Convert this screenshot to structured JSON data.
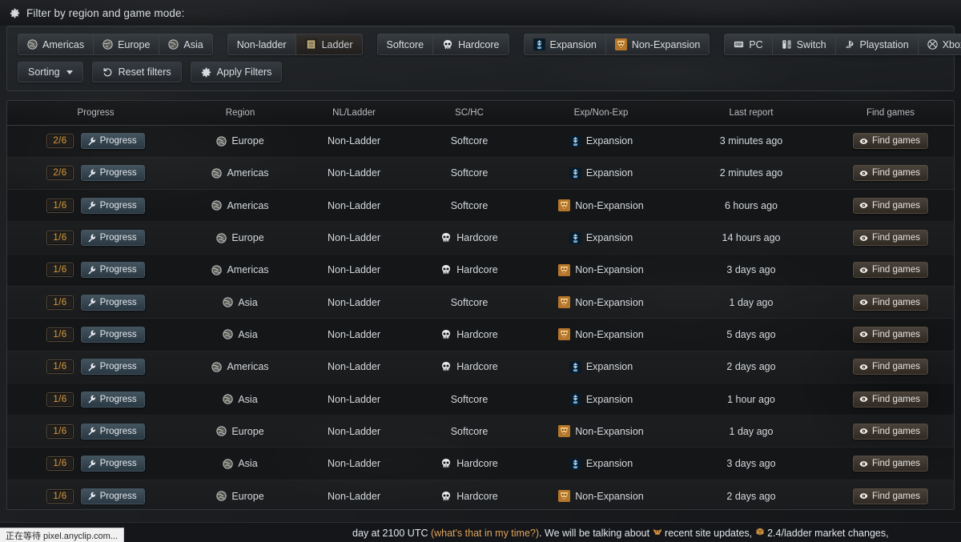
{
  "header": {
    "gear_icon": "gear-icon",
    "title": "Filter by region and game mode:"
  },
  "filters": {
    "groups": [
      {
        "name": "region",
        "buttons": [
          {
            "label": "Americas",
            "icon": "globe-icon",
            "active": true
          },
          {
            "label": "Europe",
            "icon": "globe-icon",
            "active": true
          },
          {
            "label": "Asia",
            "icon": "globe-icon",
            "active": true
          }
        ]
      },
      {
        "name": "ladder",
        "buttons": [
          {
            "label": "Non-ladder",
            "icon": "",
            "active": true
          },
          {
            "label": "Ladder",
            "icon": "ladder-icon",
            "active": false
          }
        ]
      },
      {
        "name": "core",
        "buttons": [
          {
            "label": "Softcore",
            "icon": "",
            "active": true
          },
          {
            "label": "Hardcore",
            "icon": "skull-icon",
            "active": true
          }
        ]
      },
      {
        "name": "expansion",
        "buttons": [
          {
            "label": "Expansion",
            "icon": "expansion-icon",
            "active": true
          },
          {
            "label": "Non-Expansion",
            "icon": "non-expansion-icon",
            "active": true
          }
        ]
      },
      {
        "name": "platform",
        "buttons": [
          {
            "label": "PC",
            "icon": "pc-icon",
            "active": true
          },
          {
            "label": "Switch",
            "icon": "switch-icon",
            "active": true
          },
          {
            "label": "Playstation",
            "icon": "playstation-icon",
            "active": true
          },
          {
            "label": "Xbox",
            "icon": "xbox-icon",
            "active": true
          }
        ]
      }
    ],
    "actions": {
      "sorting_label": "Sorting",
      "reset_label": "Reset filters",
      "reset_icon": "undo-icon",
      "apply_label": "Apply Filters",
      "apply_icon": "gear-icon"
    }
  },
  "table": {
    "columns": [
      "Progress",
      "Region",
      "NL/Ladder",
      "SC/HC",
      "Exp/Non-Exp",
      "Last report",
      "Find games"
    ],
    "progress_button_label": "Progress",
    "progress_button_icon": "wrench-icon",
    "find_button_label": "Find games",
    "find_button_icon": "eye-icon",
    "rows": [
      {
        "progress": "2/6",
        "region": "Europe",
        "region_icon": "globe-icon",
        "ladder": "Non-Ladder",
        "core": "Softcore",
        "core_icon": "",
        "exp": "Expansion",
        "exp_icon": "expansion-icon",
        "last_report": "3 minutes ago"
      },
      {
        "progress": "2/6",
        "region": "Americas",
        "region_icon": "globe-icon",
        "ladder": "Non-Ladder",
        "core": "Softcore",
        "core_icon": "",
        "exp": "Expansion",
        "exp_icon": "expansion-icon",
        "last_report": "2 minutes ago"
      },
      {
        "progress": "1/6",
        "region": "Americas",
        "region_icon": "globe-icon",
        "ladder": "Non-Ladder",
        "core": "Softcore",
        "core_icon": "",
        "exp": "Non-Expansion",
        "exp_icon": "non-expansion-icon",
        "last_report": "6 hours ago"
      },
      {
        "progress": "1/6",
        "region": "Europe",
        "region_icon": "globe-icon",
        "ladder": "Non-Ladder",
        "core": "Hardcore",
        "core_icon": "skull-icon",
        "exp": "Expansion",
        "exp_icon": "expansion-icon",
        "last_report": "14 hours ago"
      },
      {
        "progress": "1/6",
        "region": "Americas",
        "region_icon": "globe-icon",
        "ladder": "Non-Ladder",
        "core": "Hardcore",
        "core_icon": "skull-icon",
        "exp": "Non-Expansion",
        "exp_icon": "non-expansion-icon",
        "last_report": "3 days ago"
      },
      {
        "progress": "1/6",
        "region": "Asia",
        "region_icon": "globe-icon",
        "ladder": "Non-Ladder",
        "core": "Softcore",
        "core_icon": "",
        "exp": "Non-Expansion",
        "exp_icon": "non-expansion-icon",
        "last_report": "1 day ago"
      },
      {
        "progress": "1/6",
        "region": "Asia",
        "region_icon": "globe-icon",
        "ladder": "Non-Ladder",
        "core": "Hardcore",
        "core_icon": "skull-icon",
        "exp": "Non-Expansion",
        "exp_icon": "non-expansion-icon",
        "last_report": "5 days ago"
      },
      {
        "progress": "1/6",
        "region": "Americas",
        "region_icon": "globe-icon",
        "ladder": "Non-Ladder",
        "core": "Hardcore",
        "core_icon": "skull-icon",
        "exp": "Expansion",
        "exp_icon": "expansion-icon",
        "last_report": "2 days ago"
      },
      {
        "progress": "1/6",
        "region": "Asia",
        "region_icon": "globe-icon",
        "ladder": "Non-Ladder",
        "core": "Softcore",
        "core_icon": "",
        "exp": "Expansion",
        "exp_icon": "expansion-icon",
        "last_report": "1 hour ago"
      },
      {
        "progress": "1/6",
        "region": "Europe",
        "region_icon": "globe-icon",
        "ladder": "Non-Ladder",
        "core": "Softcore",
        "core_icon": "",
        "exp": "Non-Expansion",
        "exp_icon": "non-expansion-icon",
        "last_report": "1 day ago"
      },
      {
        "progress": "1/6",
        "region": "Asia",
        "region_icon": "globe-icon",
        "ladder": "Non-Ladder",
        "core": "Hardcore",
        "core_icon": "skull-icon",
        "exp": "Expansion",
        "exp_icon": "expansion-icon",
        "last_report": "3 days ago"
      },
      {
        "progress": "1/6",
        "region": "Europe",
        "region_icon": "globe-icon",
        "ladder": "Non-Ladder",
        "core": "Hardcore",
        "core_icon": "skull-icon",
        "exp": "Non-Expansion",
        "exp_icon": "non-expansion-icon",
        "last_report": "2 days ago"
      }
    ]
  },
  "ticker": {
    "segments": [
      {
        "text": "day at 2100 UTC ",
        "style": "plain"
      },
      {
        "text": "(what's that in my time?)",
        "style": "highlight"
      },
      {
        "text": ". We will be talking about ",
        "style": "plain"
      },
      {
        "text": "recent site updates, ",
        "style": "plain",
        "icon": "horns-icon"
      },
      {
        "text": "2.4/ladder market changes,",
        "style": "plain",
        "icon": "box-icon"
      }
    ]
  },
  "status_bar": {
    "text": "正在等待 pixel.anyclip.com..."
  },
  "colors": {
    "accent_orange": "#d79a3c",
    "link_blue": "#6fa8dc",
    "panel_bg": "#212427",
    "page_bg": "#1a1c1f"
  }
}
